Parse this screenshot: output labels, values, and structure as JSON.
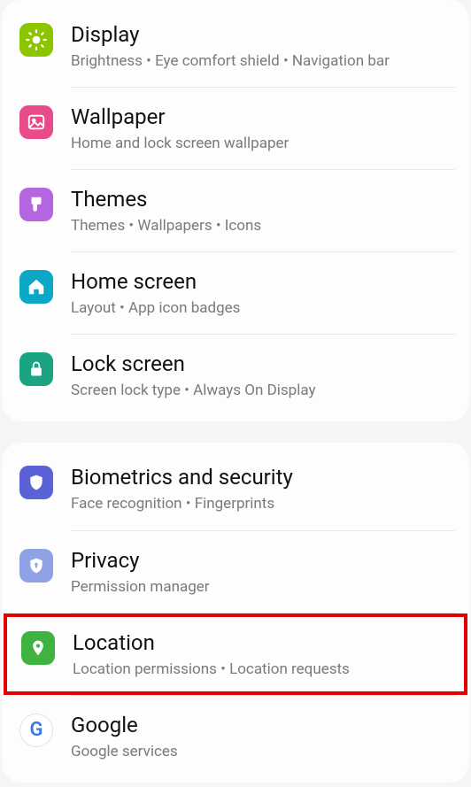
{
  "settings": {
    "display": {
      "title": "Display",
      "subtitle": "Brightness  •  Eye comfort shield  •  Navigation bar",
      "icon": "sun",
      "bg": "#8bc500"
    },
    "wallpaper": {
      "title": "Wallpaper",
      "subtitle": "Home and lock screen wallpaper",
      "icon": "picture",
      "bg": "#e84b8a"
    },
    "themes": {
      "title": "Themes",
      "subtitle": "Themes  •  Wallpapers  •  Icons",
      "icon": "brush",
      "bg": "#b466e0"
    },
    "homescreen": {
      "title": "Home screen",
      "subtitle": "Layout  •  App icon badges",
      "icon": "home",
      "bg": "#0aa7c7"
    },
    "lockscreen": {
      "title": "Lock screen",
      "subtitle": "Screen lock type  •  Always On Display",
      "icon": "lock",
      "bg": "#1aa481"
    },
    "biometrics": {
      "title": "Biometrics and security",
      "subtitle": "Face recognition  •  Fingerprints",
      "icon": "shield",
      "bg": "#5a62d6"
    },
    "privacy": {
      "title": "Privacy",
      "subtitle": "Permission manager",
      "icon": "privacy",
      "bg": "#8fa2e6"
    },
    "location": {
      "title": "Location",
      "subtitle": "Location permissions  •  Location requests",
      "icon": "pin",
      "bg": "#3fb33f"
    },
    "google": {
      "title": "Google",
      "subtitle": "Google services",
      "icon": "google",
      "bg": "#ffffff",
      "fg": "#3b78e7"
    }
  }
}
